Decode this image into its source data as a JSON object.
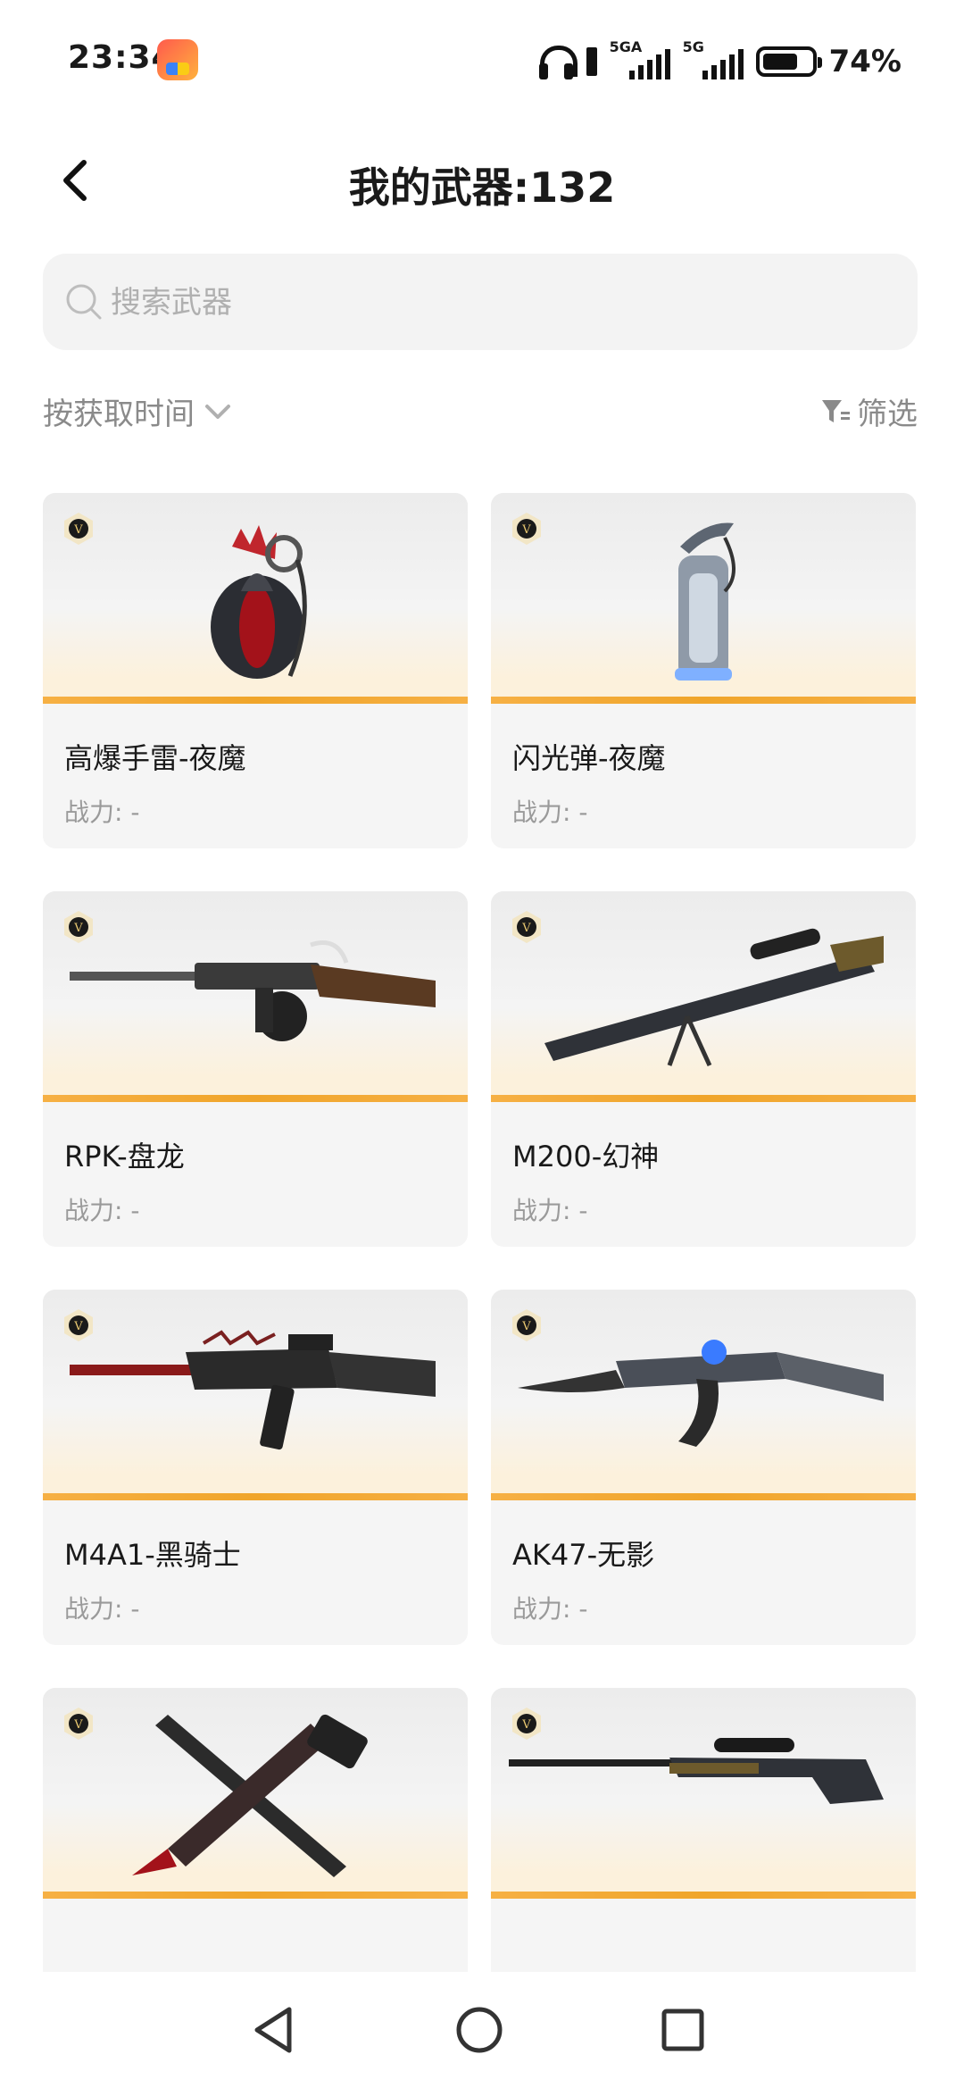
{
  "status_bar": {
    "time": "23:34",
    "signal1_label": "5GA",
    "signal2_label": "5G",
    "battery": "74%",
    "battery_level": 0.74
  },
  "header": {
    "title": "我的武器:132"
  },
  "search": {
    "placeholder": "搜索武器",
    "value": ""
  },
  "toolbar": {
    "sort_label": "按获取时间",
    "filter_label": "筛选"
  },
  "colors": {
    "accent_bar": "#f0a52a",
    "card_bg": "#f5f5f5",
    "muted_text": "#8a8a8a"
  },
  "weapons": [
    {
      "name": "高爆手雷-夜魔",
      "power": "战力: -",
      "icon": "grenade-icon"
    },
    {
      "name": "闪光弹-夜魔",
      "power": "战力: -",
      "icon": "flashbang-icon"
    },
    {
      "name": "RPK-盘龙",
      "power": "战力: -",
      "icon": "machine-gun-icon"
    },
    {
      "name": "M200-幻神",
      "power": "战力: -",
      "icon": "sniper-rifle-icon"
    },
    {
      "name": "M4A1-黑骑士",
      "power": "战力: -",
      "icon": "assault-rifle-icon"
    },
    {
      "name": "AK47-无影",
      "power": "战力: -",
      "icon": "assault-rifle-icon"
    },
    {
      "name": "",
      "power": "",
      "icon": "pistol-knife-icon"
    },
    {
      "name": "",
      "power": "",
      "icon": "sniper-rifle-icon"
    }
  ],
  "nav": {
    "back": "back-nav-icon",
    "home": "home-nav-icon",
    "recents": "recents-nav-icon"
  }
}
